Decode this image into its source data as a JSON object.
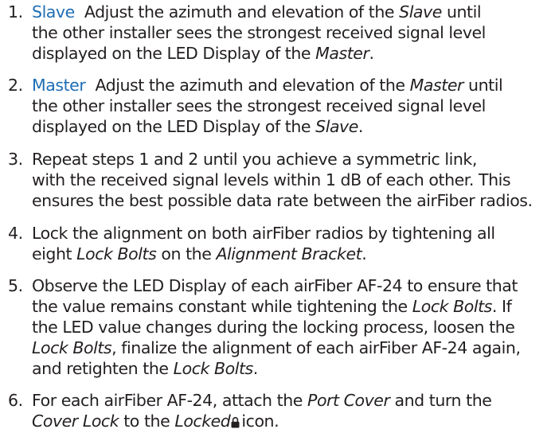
{
  "steps": [
    {
      "number": "1.",
      "keyword": "Slave",
      "lines": [
        [
          "Adjust the azimuth and elevation of the ",
          {
            "i": "Slave"
          },
          " until"
        ],
        [
          "the other installer sees the strongest received signal level"
        ],
        [
          "displayed on the LED Display of the ",
          {
            "i": "Master"
          },
          "."
        ]
      ]
    },
    {
      "number": "2.",
      "keyword": "Master",
      "lines": [
        [
          "Adjust the azimuth and elevation of the ",
          {
            "i": "Master"
          },
          " until"
        ],
        [
          "the other installer sees the strongest received signal level"
        ],
        [
          "displayed on the LED Display of the ",
          {
            "i": "Slave"
          },
          "."
        ]
      ]
    },
    {
      "number": "3.",
      "lines": [
        [
          "Repeat steps 1 and 2 until you achieve a symmetric link,"
        ],
        [
          "with the received signal levels within 1 dB of each other. This"
        ],
        [
          "ensures the best possible data rate between the airFiber radios."
        ]
      ]
    },
    {
      "number": "4.",
      "lines": [
        [
          "Lock the alignment on both airFiber radios by tightening all"
        ],
        [
          "eight ",
          {
            "i": "Lock Bolts"
          },
          " on the ",
          {
            "i": "Alignment Bracket"
          },
          "."
        ]
      ]
    },
    {
      "number": "5.",
      "lines": [
        [
          "Observe the LED Display of each airFiber AF-24 to ensure that"
        ],
        [
          "the value remains constant while tightening the ",
          {
            "i": "Lock Bolts"
          },
          ". If"
        ],
        [
          "the LED value changes during the locking process, loosen the"
        ],
        [
          {
            "i": "Lock Bolts"
          },
          ", finalize the alignment of each airFiber AF-24 again,"
        ],
        [
          "and retighten the ",
          {
            "i": "Lock Bolts"
          },
          "."
        ]
      ]
    },
    {
      "number": "6.",
      "lines": [
        [
          "For each airFiber AF-24, attach the ",
          {
            "i": "Port Cover"
          },
          " and turn the"
        ],
        [
          {
            "i": "Cover Lock"
          },
          " to the ",
          {
            "i": "Locked"
          },
          {
            "icon": "lock-icon"
          },
          "icon."
        ]
      ]
    }
  ],
  "colors": {
    "text": "#231f20",
    "keyword": "#1e6db4"
  }
}
